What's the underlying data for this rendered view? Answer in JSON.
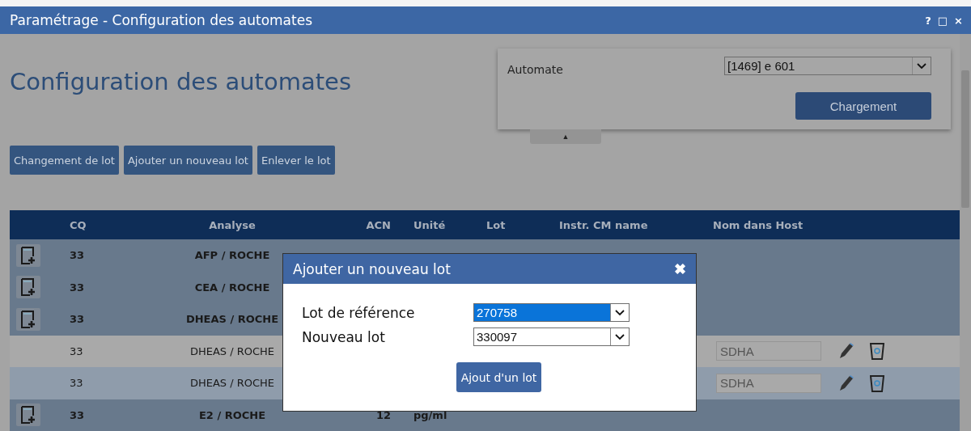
{
  "window": {
    "title": "Paramétrage - Configuration des automates",
    "controls": [
      "?",
      "□",
      "×"
    ]
  },
  "heading": "Configuration des automates",
  "automate_panel": {
    "label": "Automate",
    "value": "[1469] e 601",
    "button": "Chargement",
    "collapse": "▲"
  },
  "toolbar": [
    "Changement de lot",
    "Ajouter un nouveau lot",
    "Enlever le lot"
  ],
  "table": {
    "columns": [
      "CQ",
      "Analyse",
      "ACN",
      "Unité",
      "Lot",
      "Instr. CM name",
      "Nom dans Host"
    ],
    "rows": [
      {
        "kind": "group",
        "cq": "33",
        "analyse": "AFP / ROCHE"
      },
      {
        "kind": "group",
        "cq": "33",
        "analyse": "CEA / ROCHE"
      },
      {
        "kind": "group",
        "cq": "33",
        "analyse": "DHEAS / ROCHE"
      },
      {
        "kind": "lot",
        "cq": "33",
        "analyse": "DHEAS / ROCHE",
        "host": "SDHA"
      },
      {
        "kind": "lot",
        "cq": "33",
        "analyse": "DHEAS / ROCHE",
        "host": "SDHA"
      },
      {
        "kind": "group",
        "cq": "33",
        "analyse": "E2 / ROCHE",
        "acn": "12",
        "unite": "pg/ml"
      }
    ]
  },
  "dialog": {
    "title": "Ajouter un nouveau lot",
    "close": "✖",
    "fields": [
      {
        "label": "Lot de référence",
        "value": "270758",
        "focused": true
      },
      {
        "label": "Nouveau lot",
        "value": "330097",
        "focused": false
      }
    ],
    "button": "Ajout d'un lot"
  }
}
